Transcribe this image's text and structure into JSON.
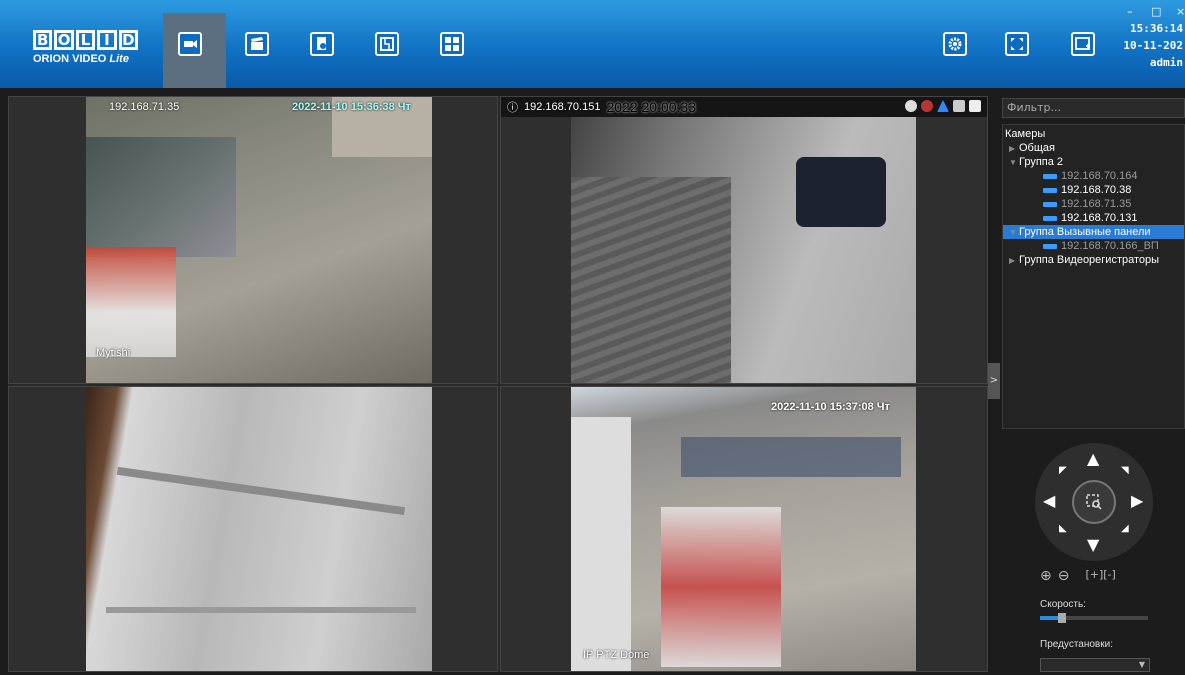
{
  "app": {
    "logo_main": [
      "B",
      "O",
      "L",
      "I",
      "D"
    ],
    "logo_sub": "ORION VIDEO",
    "logo_edition": "Lite"
  },
  "nav": [
    {
      "name": "cameras-tab-icon",
      "active": true
    },
    {
      "name": "archive-tab-icon",
      "active": false
    },
    {
      "name": "events-tab-icon",
      "active": false
    },
    {
      "name": "plan-tab-icon",
      "active": false
    },
    {
      "name": "layout-tab-icon",
      "active": false
    }
  ],
  "header_right": {
    "settings": "settings-icon",
    "fullscreen": "fullscreen-icon",
    "window": "window-icon"
  },
  "window_controls": {
    "minimize": "–",
    "maximize": "□",
    "close": "×"
  },
  "clock": {
    "time": "15:36:14",
    "date": "10-11-202",
    "user": "admin"
  },
  "cameras": [
    {
      "ip_overlay": "192.168.71.35",
      "timestamp": "2022-11-10 15:36:38 Чт",
      "caption": "Mytishi"
    },
    {
      "ip_overlay": "192.168.70.151",
      "timestamp": "2022 20:00:33",
      "caption": ""
    },
    {
      "ip_overlay": "",
      "timestamp": "",
      "caption": ""
    },
    {
      "ip_overlay": "",
      "timestamp": "2022-11-10 15:37:08 Чт",
      "caption": "IP PTZ Dome"
    }
  ],
  "sidebar": {
    "filter_placeholder": "Фильтр...",
    "tree_root": "Камеры",
    "tree": [
      {
        "label": "Общая",
        "level": 0,
        "type": "group",
        "state": "collapsed"
      },
      {
        "label": "Группа 2",
        "level": 0,
        "type": "group",
        "state": "expanded"
      },
      {
        "label": "192.168.70.164",
        "level": 1,
        "type": "camera",
        "dim": true
      },
      {
        "label": "192.168.70.38",
        "level": 1,
        "type": "camera",
        "dim": false
      },
      {
        "label": "192.168.71.35",
        "level": 1,
        "type": "camera",
        "dim": true
      },
      {
        "label": "192.168.70.131",
        "level": 1,
        "type": "camera",
        "dim": false
      },
      {
        "label": "Группа Вызывные панели",
        "level": 0,
        "type": "group",
        "state": "expanded",
        "selected": true
      },
      {
        "label": "192.168.70.166_ВП",
        "level": 1,
        "type": "camera",
        "dim": true
      },
      {
        "label": "Группа Видеорегистраторы",
        "level": 0,
        "type": "group",
        "state": "collapsed"
      }
    ],
    "toggle": ">"
  },
  "ptz": {
    "speed_label": "Скорость:",
    "speed_fraction": 0.2,
    "presets_label": "Предустановки:",
    "zoom_in": "⊕",
    "zoom_out": "⊖",
    "focus": "[+][-]"
  },
  "colors": {
    "accent": "#2a7bd6",
    "header": "#1272c4",
    "timestamp": "#99ffff"
  }
}
